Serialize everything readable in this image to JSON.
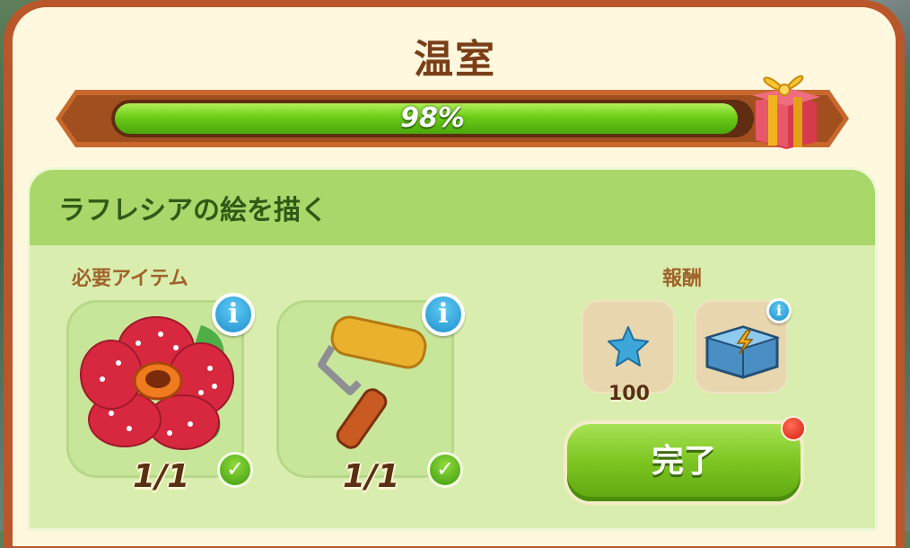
{
  "window": {
    "title": "温室"
  },
  "progress": {
    "percent_text": "98%",
    "value": 0.98
  },
  "task": {
    "title": "ラフレシアの絵を描く"
  },
  "required": {
    "label": "必要アイテム",
    "items": [
      {
        "name": "rafflesia flower painting",
        "count": "1/1",
        "icon": "flower-icon",
        "info": "i"
      },
      {
        "name": "paint roller",
        "count": "1/1",
        "icon": "paint-roller-icon",
        "info": "i"
      }
    ]
  },
  "rewards": {
    "label": "報酬",
    "items": [
      {
        "icon": "blue-star-icon",
        "amount": "100"
      },
      {
        "icon": "energy-chest-icon",
        "info": "i"
      }
    ]
  },
  "actions": {
    "complete_label": "完了"
  },
  "colors": {
    "panel_brown": "#b9572a",
    "progress_green": "#6dcc16",
    "card_green": "#d9eeae",
    "info_blue": "#1f8fcf",
    "notification_red": "#d71d10"
  }
}
